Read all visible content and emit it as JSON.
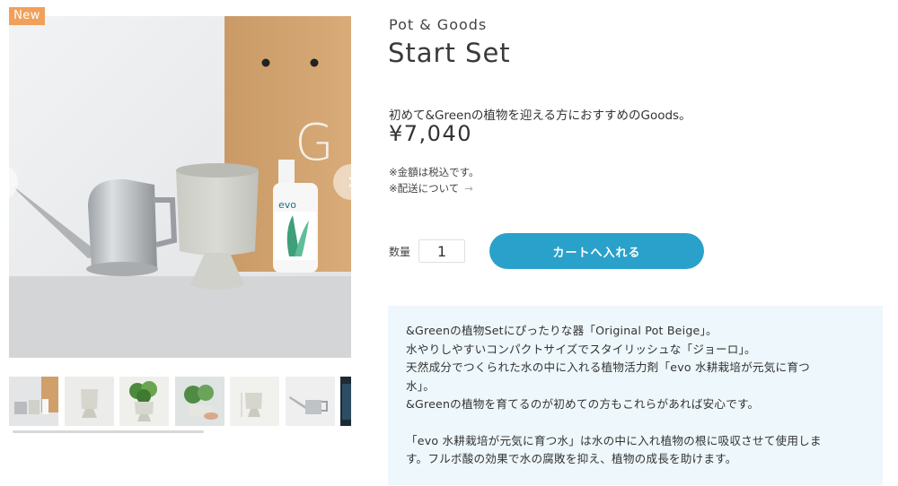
{
  "badge": "New",
  "product": {
    "brand": "Pot & Goods",
    "title": "Start Set",
    "lead": "初めて&Greenの植物を迎える方におすすめのGoods。",
    "price": "¥7,040",
    "tax_note": "※金額は税込です。",
    "shipping_link": "※配送について"
  },
  "purchase": {
    "qty_label": "数量",
    "qty_value": "1",
    "cart_button": "カートへ入れる"
  },
  "description": {
    "lines_1": [
      "&Greenの植物Setにぴったりな器「Original Pot Beige」。",
      "水やりしやすいコンパクトサイズでスタイリッシュな「ジョーロ」。",
      "天然成分でつくられた水の中に入れる植物活力剤「evo 水耕栽培が元気に育つ",
      "水」。",
      "&Greenの植物を育てるのが初めての方もこれらがあれば安心です。"
    ],
    "lines_2": [
      "「evo 水耕栽培が元気に育つ水」は水の中に入れ植物の根に吸収させて使用しま",
      "す。フルボ酸の効果で水の腐敗を抑え、植物の成長を助けます。"
    ]
  },
  "image_text": {
    "box_logo": "G",
    "bottle_label": "evo"
  },
  "colors": {
    "accent": "#2aa1ca",
    "badge": "#f0a05a",
    "desc_bg": "#eef7fb"
  }
}
